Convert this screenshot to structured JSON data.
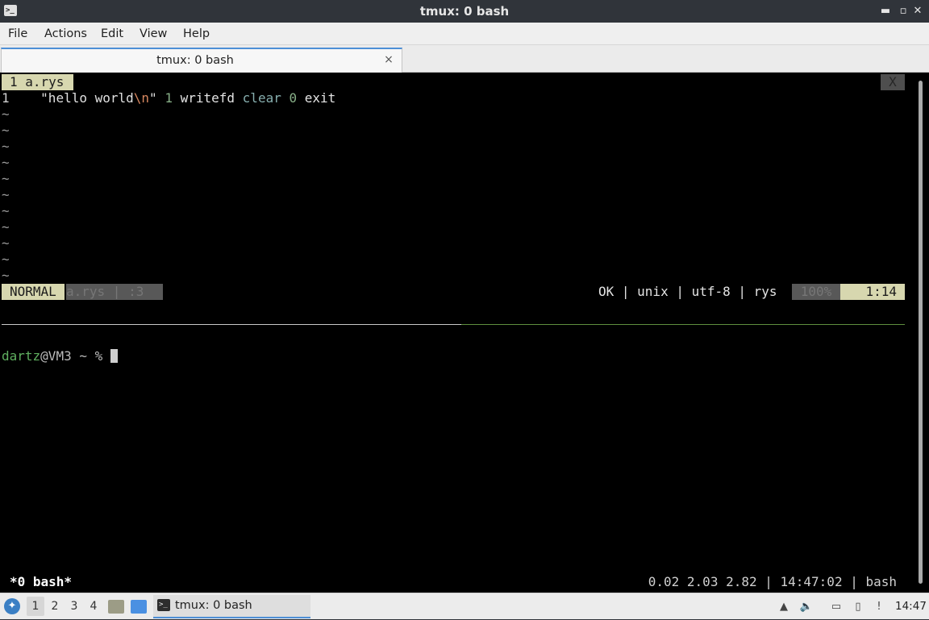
{
  "window": {
    "title": "tmux: 0 bash",
    "minimize_glyph": "▬",
    "restore_glyph": "▫",
    "maximize_glyph": "□",
    "close_glyph": "✕"
  },
  "menu": {
    "items": [
      "File",
      "Actions",
      "Edit",
      "View",
      "Help"
    ]
  },
  "tab": {
    "label": "tmux: 0 bash",
    "close_glyph": "×"
  },
  "vim": {
    "buffer_tab": "1 a.rys",
    "close_label": "X",
    "line_number": "1",
    "code": {
      "str_open": "\"hello world",
      "escape": "\\n",
      "str_close": "\"",
      "num1": "1",
      "fn": "writefd",
      "kw": "clear",
      "num2": "0",
      "exit": "exit"
    },
    "tilde": "~",
    "status": {
      "mode": "NORMAL",
      "file": "a.rys | :3",
      "right": "OK | unix | utf-8 | rys",
      "percent": "100%",
      "position": "1:14"
    }
  },
  "shell": {
    "user": "dartz",
    "rest": "@VM3 ~ % "
  },
  "tmux": {
    "window": "*0 bash*",
    "right": "0.02 2.03 2.82 | 14:47:02 | bash"
  },
  "taskbar": {
    "workspaces": [
      "1",
      "2",
      "3",
      "4"
    ],
    "active_workspace": "1",
    "task_label": "tmux: 0 bash",
    "clock": "14:47",
    "colors": {
      "accent": "#4d8fd6",
      "file_manager": "#9c9c86",
      "desktop": "#4a90e2"
    }
  },
  "colors": {
    "terminal_bg": "#000000",
    "vim_status": "#d7d7af",
    "prompt_user": "#5faf5f"
  }
}
